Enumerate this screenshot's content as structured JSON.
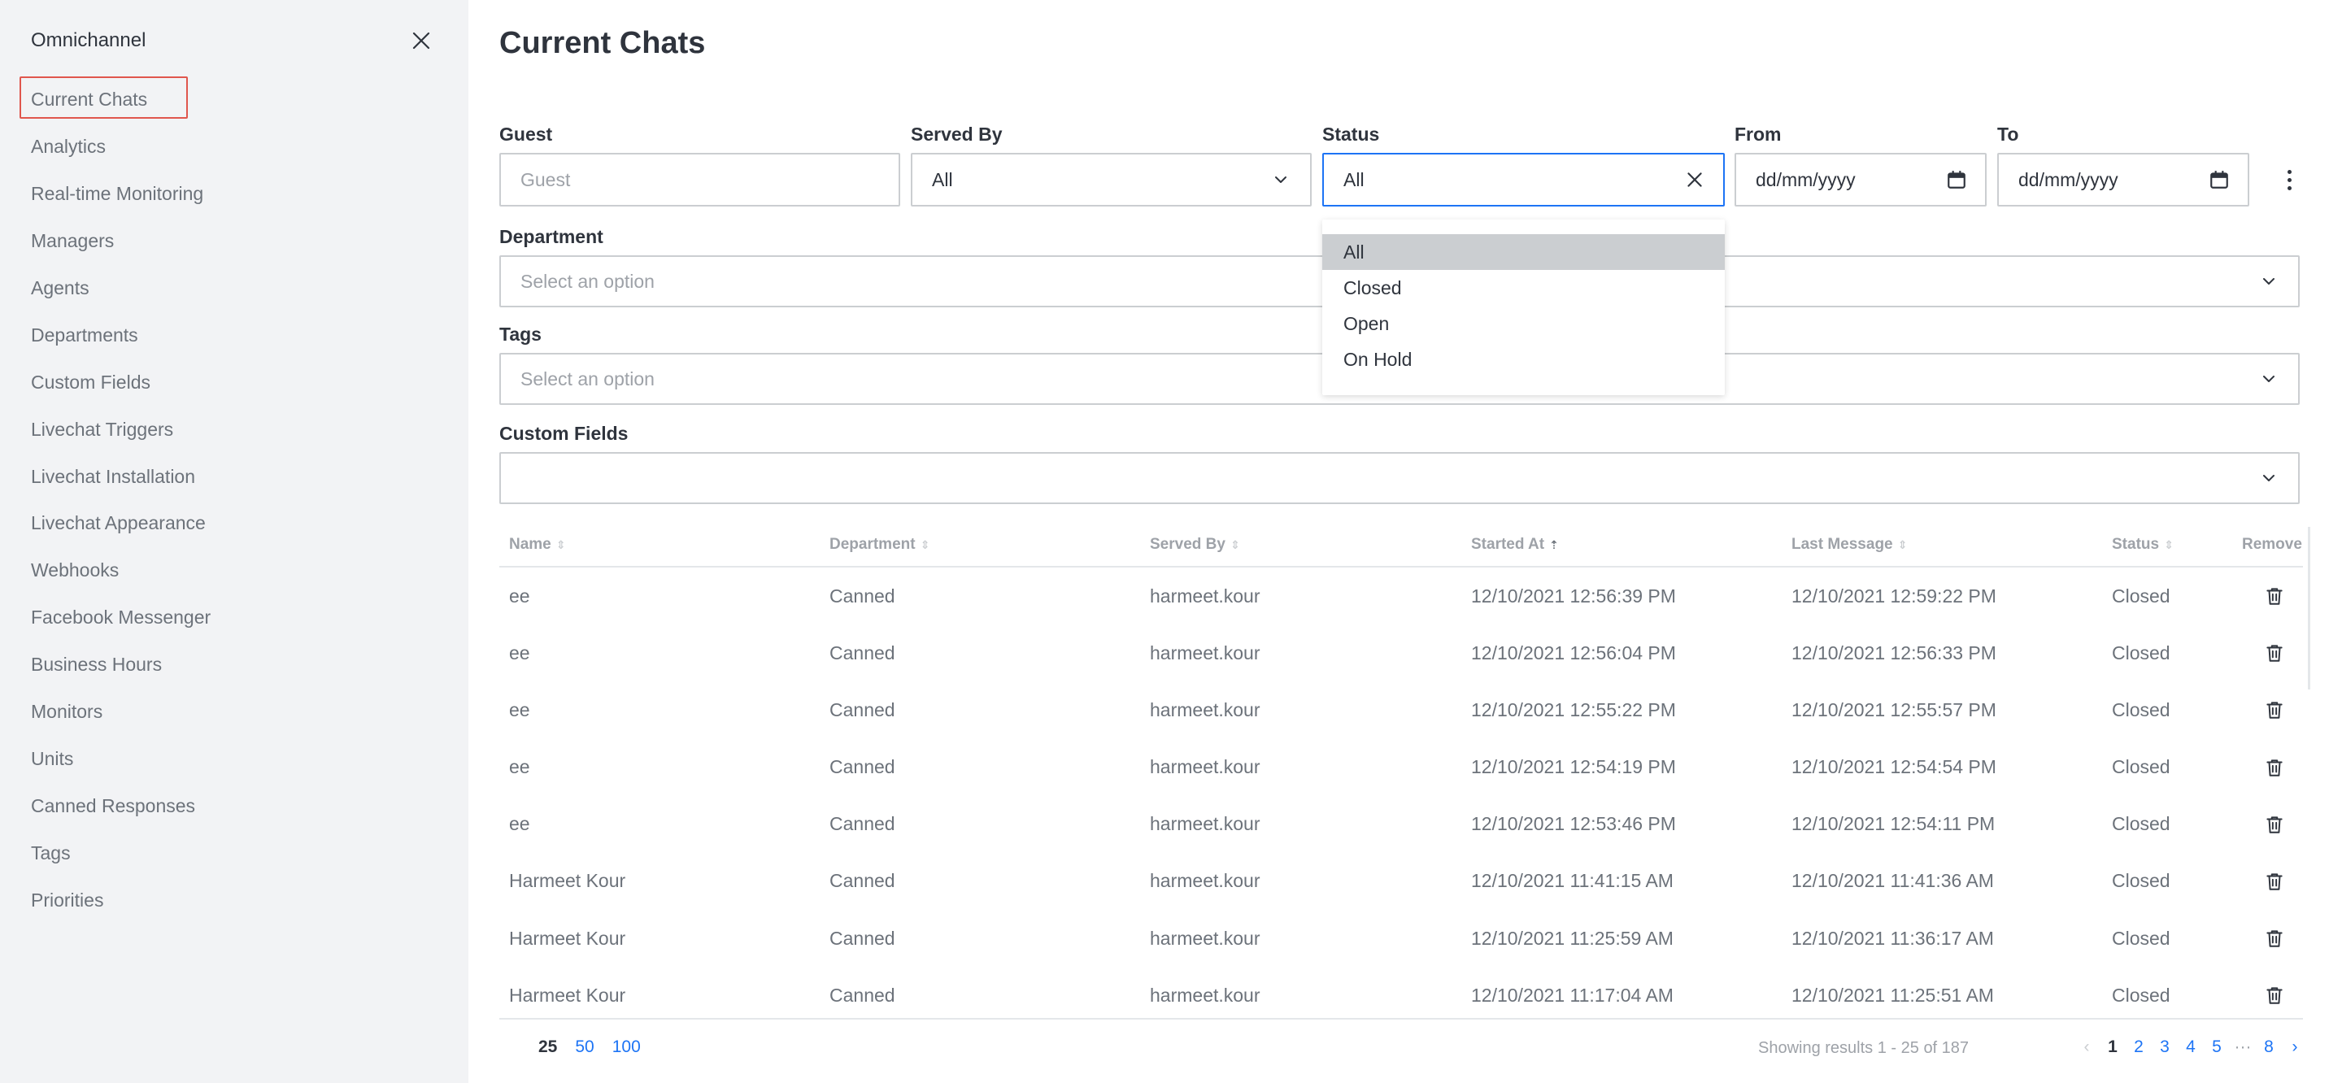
{
  "sidebar": {
    "title": "Omnichannel",
    "items": [
      {
        "label": "Current Chats"
      },
      {
        "label": "Analytics"
      },
      {
        "label": "Real-time Monitoring"
      },
      {
        "label": "Managers"
      },
      {
        "label": "Agents"
      },
      {
        "label": "Departments"
      },
      {
        "label": "Custom Fields"
      },
      {
        "label": "Livechat Triggers"
      },
      {
        "label": "Livechat Installation"
      },
      {
        "label": "Livechat Appearance"
      },
      {
        "label": "Webhooks"
      },
      {
        "label": "Facebook Messenger"
      },
      {
        "label": "Business Hours"
      },
      {
        "label": "Monitors"
      },
      {
        "label": "Units"
      },
      {
        "label": "Canned Responses"
      },
      {
        "label": "Tags"
      },
      {
        "label": "Priorities"
      }
    ]
  },
  "main": {
    "title": "Current Chats",
    "filters": {
      "guest": {
        "label": "Guest",
        "placeholder": "Guest"
      },
      "served_by": {
        "label": "Served By",
        "value": "All"
      },
      "status": {
        "label": "Status",
        "value": "All",
        "options": [
          "All",
          "Closed",
          "Open",
          "On Hold"
        ]
      },
      "from": {
        "label": "From",
        "value": "dd/mm/yyyy"
      },
      "to": {
        "label": "To",
        "value": "dd/mm/yyyy"
      },
      "department": {
        "label": "Department",
        "placeholder": "Select an option"
      },
      "tags": {
        "label": "Tags",
        "placeholder": "Select an option"
      },
      "custom_fields": {
        "label": "Custom Fields"
      }
    },
    "table": {
      "columns": [
        "Name",
        "Department",
        "Served By",
        "Started At",
        "Last Message",
        "Status",
        "Remove"
      ],
      "rows": [
        {
          "name": "ee",
          "department": "Canned",
          "served_by": "harmeet.kour",
          "started_at": "12/10/2021 12:56:39 PM",
          "last_message": "12/10/2021 12:59:22 PM",
          "status": "Closed"
        },
        {
          "name": "ee",
          "department": "Canned",
          "served_by": "harmeet.kour",
          "started_at": "12/10/2021 12:56:04 PM",
          "last_message": "12/10/2021 12:56:33 PM",
          "status": "Closed"
        },
        {
          "name": "ee",
          "department": "Canned",
          "served_by": "harmeet.kour",
          "started_at": "12/10/2021 12:55:22 PM",
          "last_message": "12/10/2021 12:55:57 PM",
          "status": "Closed"
        },
        {
          "name": "ee",
          "department": "Canned",
          "served_by": "harmeet.kour",
          "started_at": "12/10/2021 12:54:19 PM",
          "last_message": "12/10/2021 12:54:54 PM",
          "status": "Closed"
        },
        {
          "name": "ee",
          "department": "Canned",
          "served_by": "harmeet.kour",
          "started_at": "12/10/2021 12:53:46 PM",
          "last_message": "12/10/2021 12:54:11 PM",
          "status": "Closed"
        },
        {
          "name": "Harmeet Kour",
          "department": "Canned",
          "served_by": "harmeet.kour",
          "started_at": "12/10/2021 11:41:15 AM",
          "last_message": "12/10/2021 11:41:36 AM",
          "status": "Closed"
        },
        {
          "name": "Harmeet Kour",
          "department": "Canned",
          "served_by": "harmeet.kour",
          "started_at": "12/10/2021 11:25:59 AM",
          "last_message": "12/10/2021 11:36:17 AM",
          "status": "Closed"
        },
        {
          "name": "Harmeet Kour",
          "department": "Canned",
          "served_by": "harmeet.kour",
          "started_at": "12/10/2021 11:17:04 AM",
          "last_message": "12/10/2021 11:25:51 AM",
          "status": "Closed"
        }
      ]
    },
    "footer": {
      "per_page": [
        "25",
        "50",
        "100"
      ],
      "showing": "Showing results 1 - 25 of 187",
      "pages": [
        "1",
        "2",
        "3",
        "4",
        "5",
        "···",
        "8"
      ]
    }
  }
}
